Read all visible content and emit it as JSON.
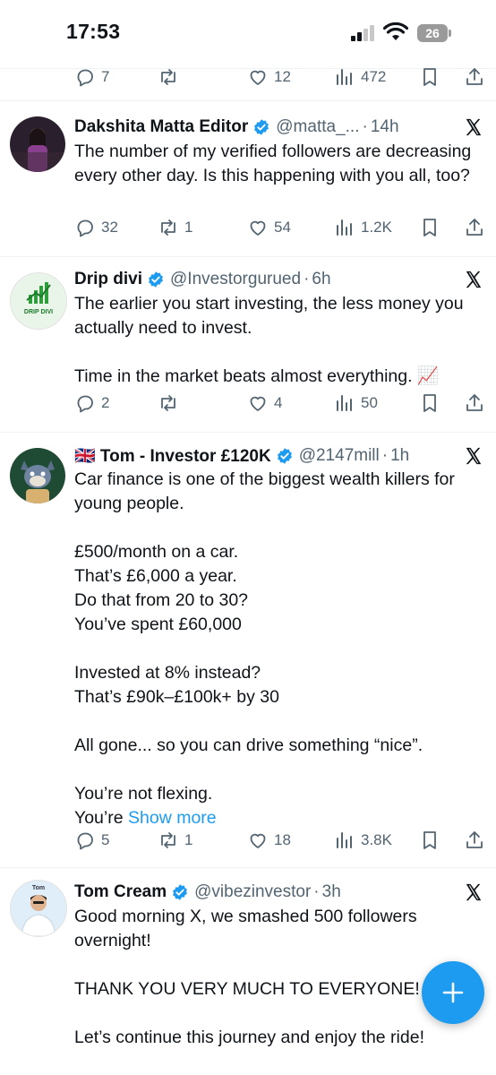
{
  "status_bar": {
    "time": "17:53",
    "battery": "26"
  },
  "prev_tweet_stats": {
    "replies": "7",
    "reposts": "",
    "likes": "12",
    "views": "472"
  },
  "tweets": [
    {
      "name": "Dakshita Matta Editor",
      "handle": "@matta_...",
      "age": "14h",
      "lines": [
        "The number of my verified followers are decreasing every other day. Is this happening with you all, too?"
      ],
      "stats": {
        "replies": "32",
        "reposts": "1",
        "likes": "54",
        "views": "1.2K"
      }
    },
    {
      "name": "Drip divi",
      "handle": "@Investorgurued",
      "age": "6h",
      "avatar_text": "DRIP DIVI",
      "lines": [
        "The earlier you start investing, the less money you actually need to invest.",
        "",
        "Time in the market beats almost everything. 📈"
      ],
      "stats": {
        "replies": "2",
        "reposts": "",
        "likes": "4",
        "views": "50"
      }
    },
    {
      "name": "🇬🇧 Tom - Investor £120K",
      "handle": "@2147mill",
      "age": "1h",
      "lines": [
        "Car finance is one of the biggest wealth killers for young people.",
        "",
        "£500/month on a car.",
        "That’s £6,000 a year.",
        "Do that from 20 to 30?",
        "You’ve spent £60,000",
        "",
        "Invested at 8% instead?",
        "That’s £90k–£100k+ by 30",
        "",
        "All gone... so you can drive something “nice”.",
        "",
        "You’re not flexing."
      ],
      "last_line_prefix": "You’re ",
      "show_more": "Show more",
      "stats": {
        "replies": "5",
        "reposts": "1",
        "likes": "18",
        "views": "3.8K"
      }
    },
    {
      "name": "Tom Cream",
      "handle": "@vibezinvestor",
      "age": "3h",
      "avatar_text": "Tom",
      "lines": [
        "Good morning X, we smashed 500 followers overnight!",
        "",
        "THANK YOU VERY MUCH TO EVERYONE!",
        "",
        "Let’s continue this journey and enjoy the ride!"
      ]
    }
  ],
  "colors": {
    "accent": "#1d9bf0",
    "muted": "#536471",
    "text": "#0f1419"
  }
}
